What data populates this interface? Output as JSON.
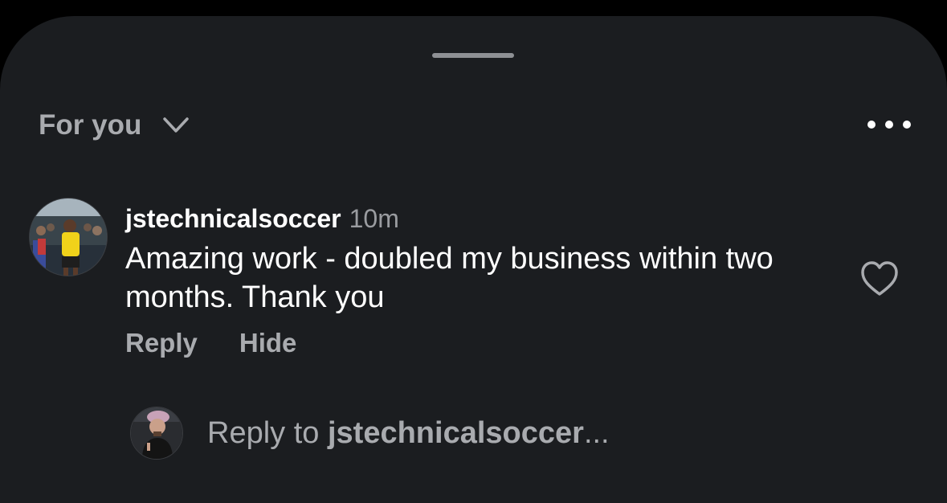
{
  "header": {
    "feed_label": "For you",
    "chevron_icon": "chevron-down-icon",
    "more_icon": "more-options-icon"
  },
  "comment": {
    "username": "jstechnicalsoccer",
    "time": "10m",
    "text": "Amazing work - doubled my business within two months. Thank you",
    "reply_label": "Reply",
    "hide_label": "Hide",
    "like_icon": "heart-icon"
  },
  "reply_box": {
    "prefix": "Reply to ",
    "handle": "jstechnicalsoccer",
    "suffix": "..."
  },
  "colors": {
    "sheet_background": "#1b1d20",
    "primary_text": "#ffffff",
    "secondary_text": "#a9abaf"
  }
}
